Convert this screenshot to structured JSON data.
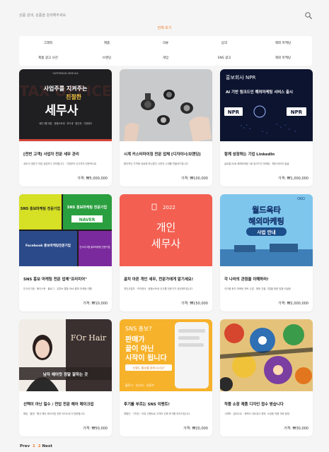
{
  "search": {
    "placeholder": "상품 검색, 상품을 검색해주세요"
  },
  "filter": {
    "all_label": "전체 보기"
  },
  "categories": [
    "그래픽",
    "제품",
    "의류",
    "음악",
    "해외 마케팅",
    "제품 광고 사진",
    "브랜딩",
    "게임",
    "SNS 광고",
    "해외 마케팅"
  ],
  "products": [
    {
      "title": "[전번 고객] 사업자 전문 세무 관리",
      "desc": "세무사 대표가 직접 상담하고 관리합니다 · 기장부터 신고까지 전문적으로",
      "price": "가격: ₩5,000,000",
      "thumb": {
        "top": "SUPERMAN SEMUSA",
        "line1": "사업주를 지켜주는",
        "line2": "친절한",
        "big": "세무사",
        "bg_word": "TAX OFFICE",
        "note": "세무그룹 대표 · 종합소득세 · 부가세 · 법인세 · 기장대리",
        "bg": "#1f1f22",
        "accent": "#d3473a"
      }
    },
    {
      "title": "시계 커스터마이징 전문 업체 [디자이너/브랜딩]",
      "desc": "합리적인 가격에 세상에 하나뿐인 나만의 시계를 만들어드립니다",
      "price": "가격: ₩100,000",
      "thumb": {
        "bg": "#c9cacc"
      }
    },
    {
      "title": "함께 성장하는 기업 LinkedIn",
      "desc": "글로벌 B2B 해외마케팅 1위 링크드인 마케팅 · 해외 바이어 발굴",
      "price": "가격: ₩1,000,000",
      "thumb": {
        "top": "홍보회사 NPR",
        "line1": "AI 기반 링크드인 해외마케팅 서비스 출시",
        "logo": "NPR",
        "bg": "#0c1430"
      }
    },
    {
      "title": "SNS 홍보 마케팅 전문 업체\"프리미어\"",
      "desc": "인스타그램 · 페이스북 · 블로그 · 유튜브 통합 SNS 홍보 마케팅 대행",
      "price": "가격: ₩10,000",
      "thumb": {
        "t1": "SNS 홍보마케팅 전문기업",
        "t2": "SNS 홍보마케팅 전문기업",
        "t3": "NAVER",
        "t4": "Facebook 홍보마케팅전문기업",
        "t5": "인스타그램 홍보마케팅 전문기업"
      }
    },
    {
      "title": "골치 아픈 개인 세무, 전문가에게 맡기세요!",
      "desc": "개인사업자 · 프리랜서 · 종합소득세 신고를 전문가가 대신해드립니다",
      "price": "가격: ₩150,000",
      "thumb": {
        "year": "2022",
        "big1": "개인",
        "big2": "세무사",
        "bg": "#f35f50"
      }
    },
    {
      "title": "각 나라의 관점을 이해하라!",
      "desc": "국가별 현지 마케팅 전략 수립 · 해외 진출 기업을 위한 맞춤 컨설팅",
      "price": "가격: ₩2,000,000",
      "thumb": {
        "brand": "OKO",
        "big1": "월드옥타",
        "big2": "해외마케팅",
        "badge": "사업 안내",
        "bg": "#7fc6ec"
      }
    },
    {
      "title": "선택이 아닌 필수 / 전업 전문 헤어 메이크업",
      "desc": "웨딩 · 촬영 · 행사 헤어 메이크업 전문 아티스트가 방문합니다",
      "price": "가격: ₩50,000",
      "thumb": {
        "brand": "FOr Hair",
        "cap": "남자 헤어컷 정말 잘하는 곳",
        "bg": "#3b3030"
      }
    },
    {
      "title": "후기를 부르는 SNS 이벤트!",
      "desc": "체험단 · 기자단 · 리뷰 이벤트로 고객의 진짜 후기를 모아드립니다",
      "price": "가격: ₩20,000",
      "thumb": {
        "q": "SNS 홍보?",
        "l1": "판매가",
        "l2": "끝이 아닌",
        "l3": "시작이 됩니다",
        "cta": "브랜드 홍보를 원하시나요?",
        "foot": "블로그 · 인스타 · 유튜브",
        "bg": "#f7b22b"
      }
    },
    {
      "title": "작품 소장 제품 디자인 접수 받습니다",
      "desc": "그래픽 · 일러스트 · 캐릭터 아트워크 제작, 소장용 작품 의뢰 환영",
      "price": "가격: ₩30,000",
      "thumb": {
        "bg": "#e5c27a"
      }
    }
  ],
  "pager": {
    "prev": "Prev",
    "page1": "1",
    "page2": "2",
    "next": "Next"
  },
  "colors": {
    "accent": "#f07a2a",
    "page_bg": "#f5f5f5"
  }
}
